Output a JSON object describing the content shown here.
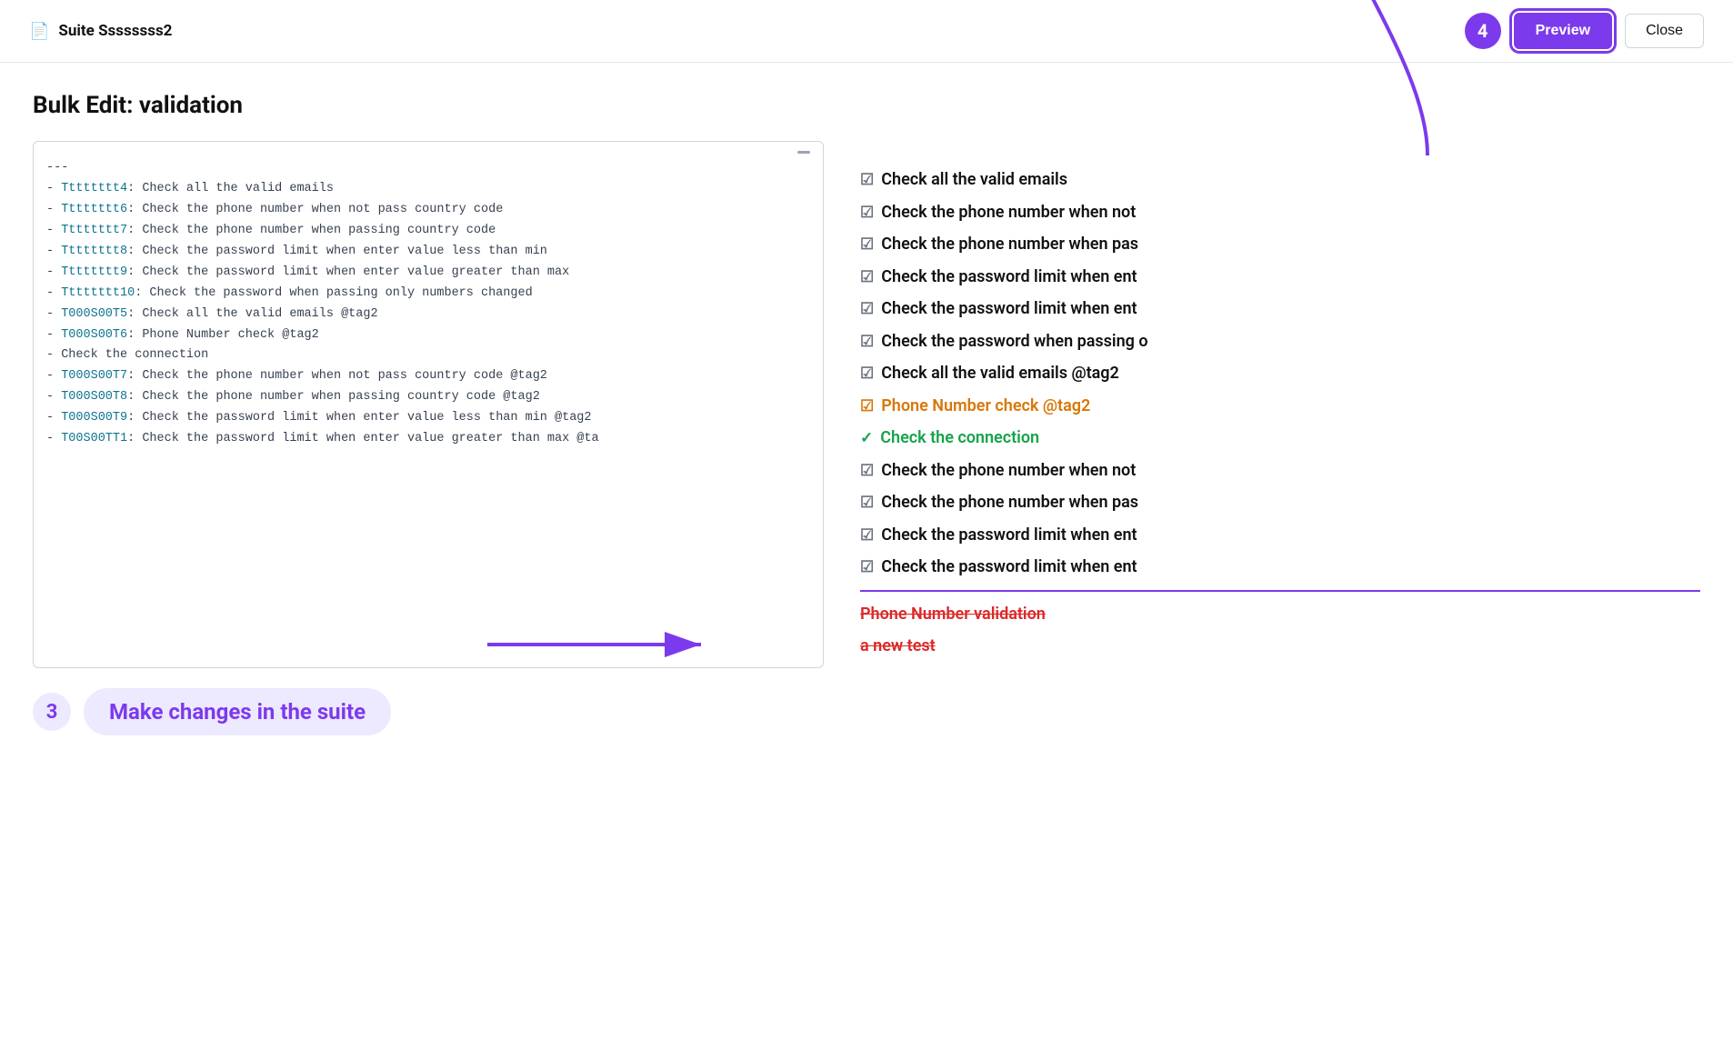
{
  "header": {
    "suite_label": "Suite ",
    "suite_name": "Ssssssss2",
    "step4_badge": "4",
    "preview_btn": "Preview",
    "close_btn": "Close"
  },
  "page": {
    "title": "Bulk Edit: validation"
  },
  "editor": {
    "separator": "---",
    "minimize_label": "—",
    "lines": [
      {
        "dash": "- ",
        "id": "Tttttttt4",
        "desc": ": Check all the valid emails"
      },
      {
        "dash": "- ",
        "id": "Tttttttt6",
        "desc": ": Check the phone number when not pass country code"
      },
      {
        "dash": "- ",
        "id": "Tttttttt7",
        "desc": ": Check the phone number when passing country code"
      },
      {
        "dash": "- ",
        "id": "Tttttttt8",
        "desc": ": Check the password limit when enter value less than min"
      },
      {
        "dash": "- ",
        "id": "Tttttttt9",
        "desc": ": Check the password limit when enter value greater than max"
      },
      {
        "dash": "- ",
        "id": "Tttttttt10",
        "desc": ": Check the password when passing only numbers changed"
      },
      {
        "dash": "- ",
        "id": "T000S00T5",
        "desc": ": Check all the valid emails @tag2"
      },
      {
        "dash": "- ",
        "id": "T000S00T6",
        "desc": ": Phone Number check @tag2"
      },
      {
        "dash": "- ",
        "id": null,
        "desc": "Check the connection"
      },
      {
        "dash": "- ",
        "id": "T000S00T7",
        "desc": ": Check the phone number when not pass country code @tag2"
      },
      {
        "dash": "- ",
        "id": "T000S00T8",
        "desc": ": Check the phone number when passing country code @tag2"
      },
      {
        "dash": "- ",
        "id": "T000S00T9",
        "desc": ": Check the password limit when enter value less than min @tag2"
      },
      {
        "dash": "- ",
        "id": "T00S00TT1",
        "desc": ": Check the password limit when enter value greater than max @ta"
      }
    ]
  },
  "step3": {
    "badge": "3",
    "label": "Make changes in the suite"
  },
  "test_list": {
    "items": [
      {
        "text": "Check all the valid emails",
        "type": "normal",
        "icon": "☑"
      },
      {
        "text": "Check the phone number when not",
        "type": "normal",
        "icon": "☑"
      },
      {
        "text": "Check the phone number when pas",
        "type": "normal",
        "icon": "☑"
      },
      {
        "text": "Check the password limit when ent",
        "type": "normal",
        "icon": "☑"
      },
      {
        "text": "Check the password limit when ent",
        "type": "normal",
        "icon": "☑"
      },
      {
        "text": "Check the password when passing o",
        "type": "normal",
        "icon": "☑"
      },
      {
        "text": "Check all the valid emails @tag2",
        "type": "normal",
        "icon": "☑"
      },
      {
        "text": "Phone Number check @tag2",
        "type": "orange",
        "icon": "☑"
      },
      {
        "text": "Check the connection",
        "type": "green",
        "icon": "✓"
      },
      {
        "text": "Check the phone number when not",
        "type": "normal",
        "icon": "☑"
      },
      {
        "text": "Check the phone number when pas",
        "type": "normal",
        "icon": "☑"
      },
      {
        "text": "Check the password limit when ent",
        "type": "normal",
        "icon": "☑"
      },
      {
        "text": "Check the password limit when ent",
        "type": "normal",
        "icon": "☑"
      },
      {
        "divider": true
      },
      {
        "text": "Phone Number validation",
        "type": "deleted",
        "icon": ""
      },
      {
        "text": "a new test",
        "type": "deleted",
        "icon": ""
      }
    ]
  }
}
